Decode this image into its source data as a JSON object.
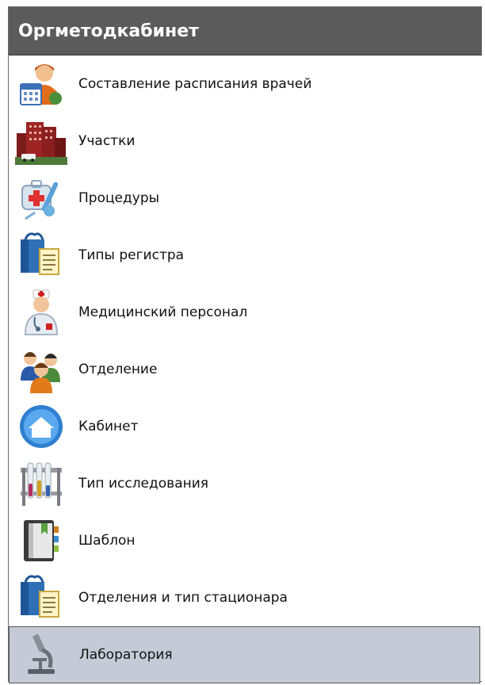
{
  "panel": {
    "title": "Оргметодкабинет"
  },
  "items": [
    {
      "label": "Составление расписания врачей",
      "icon": "doctor-schedule-icon"
    },
    {
      "label": "Участки",
      "icon": "buildings-icon"
    },
    {
      "label": "Процедуры",
      "icon": "medical-kit-icon"
    },
    {
      "label": "Типы регистра",
      "icon": "register-types-icon"
    },
    {
      "label": "Медицинский персонал",
      "icon": "nurse-icon"
    },
    {
      "label": "Отделение",
      "icon": "people-group-icon"
    },
    {
      "label": "Кабинет",
      "icon": "home-circle-icon"
    },
    {
      "label": "Тип исследования",
      "icon": "test-tubes-icon"
    },
    {
      "label": "Шаблон",
      "icon": "template-book-icon"
    },
    {
      "label": "Отделения и тип стационара",
      "icon": "register-types-icon"
    },
    {
      "label": "Лаборатория",
      "icon": "microscope-icon",
      "selected": true
    }
  ],
  "colors": {
    "header_bg": "#5b5b5b",
    "selected_bg": "#c5cad6"
  }
}
